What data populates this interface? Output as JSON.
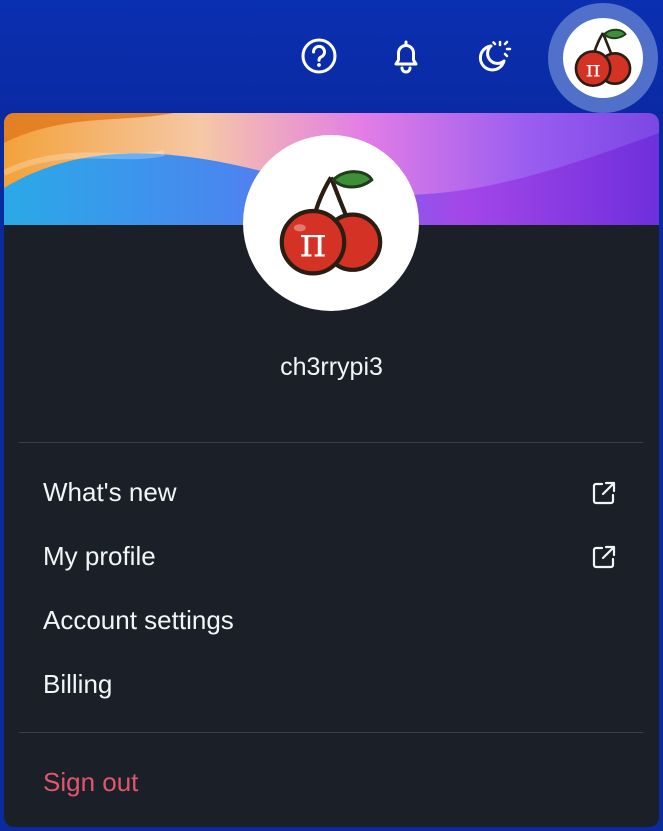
{
  "topbar": {
    "help_icon": "help-circle-icon",
    "notifications_icon": "bell-icon",
    "theme_icon": "moon-sun-icon",
    "avatar_icon": "cherry-pi-avatar"
  },
  "profile": {
    "username": "ch3rrypi3"
  },
  "menu": {
    "items": [
      {
        "label": "What's new",
        "external": true
      },
      {
        "label": "My profile",
        "external": true
      },
      {
        "label": "Account settings",
        "external": false
      },
      {
        "label": "Billing",
        "external": false
      }
    ],
    "sign_out": "Sign out"
  },
  "colors": {
    "topbar": "#0a2fb0",
    "panel": "#1b2028",
    "sign_out": "#e0566b",
    "text": "#f3f4f6"
  }
}
